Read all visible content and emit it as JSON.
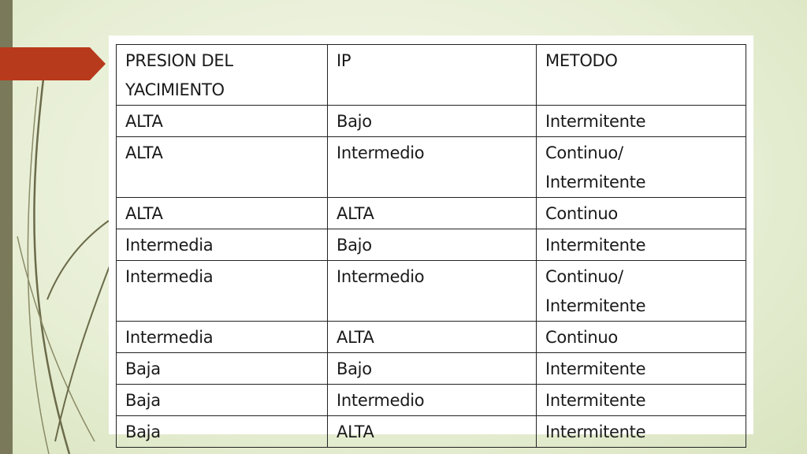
{
  "table": {
    "headers": [
      "PRESION DEL\nYACIMIENTO",
      "IP",
      "METODO"
    ],
    "rows": [
      [
        "ALTA",
        "Bajo",
        "Intermitente"
      ],
      [
        "ALTA",
        "Intermedio",
        "Continuo/\nIntermitente"
      ],
      [
        "ALTA",
        "ALTA",
        "Continuo"
      ],
      [
        "Intermedia",
        "Bajo",
        "Intermitente"
      ],
      [
        "Intermedia",
        "Intermedio",
        "Continuo/\nIntermitente"
      ],
      [
        "Intermedia",
        "ALTA",
        "Continuo"
      ],
      [
        "Baja",
        "Bajo",
        "Intermitente"
      ],
      [
        "Baja",
        "Intermedio",
        "Intermitente"
      ],
      [
        "Baja",
        "ALTA",
        "Intermitente"
      ]
    ]
  },
  "theme": {
    "accent": "#b83a1c",
    "bar": "#7a7a5a",
    "vine": "#6b6b4a"
  }
}
